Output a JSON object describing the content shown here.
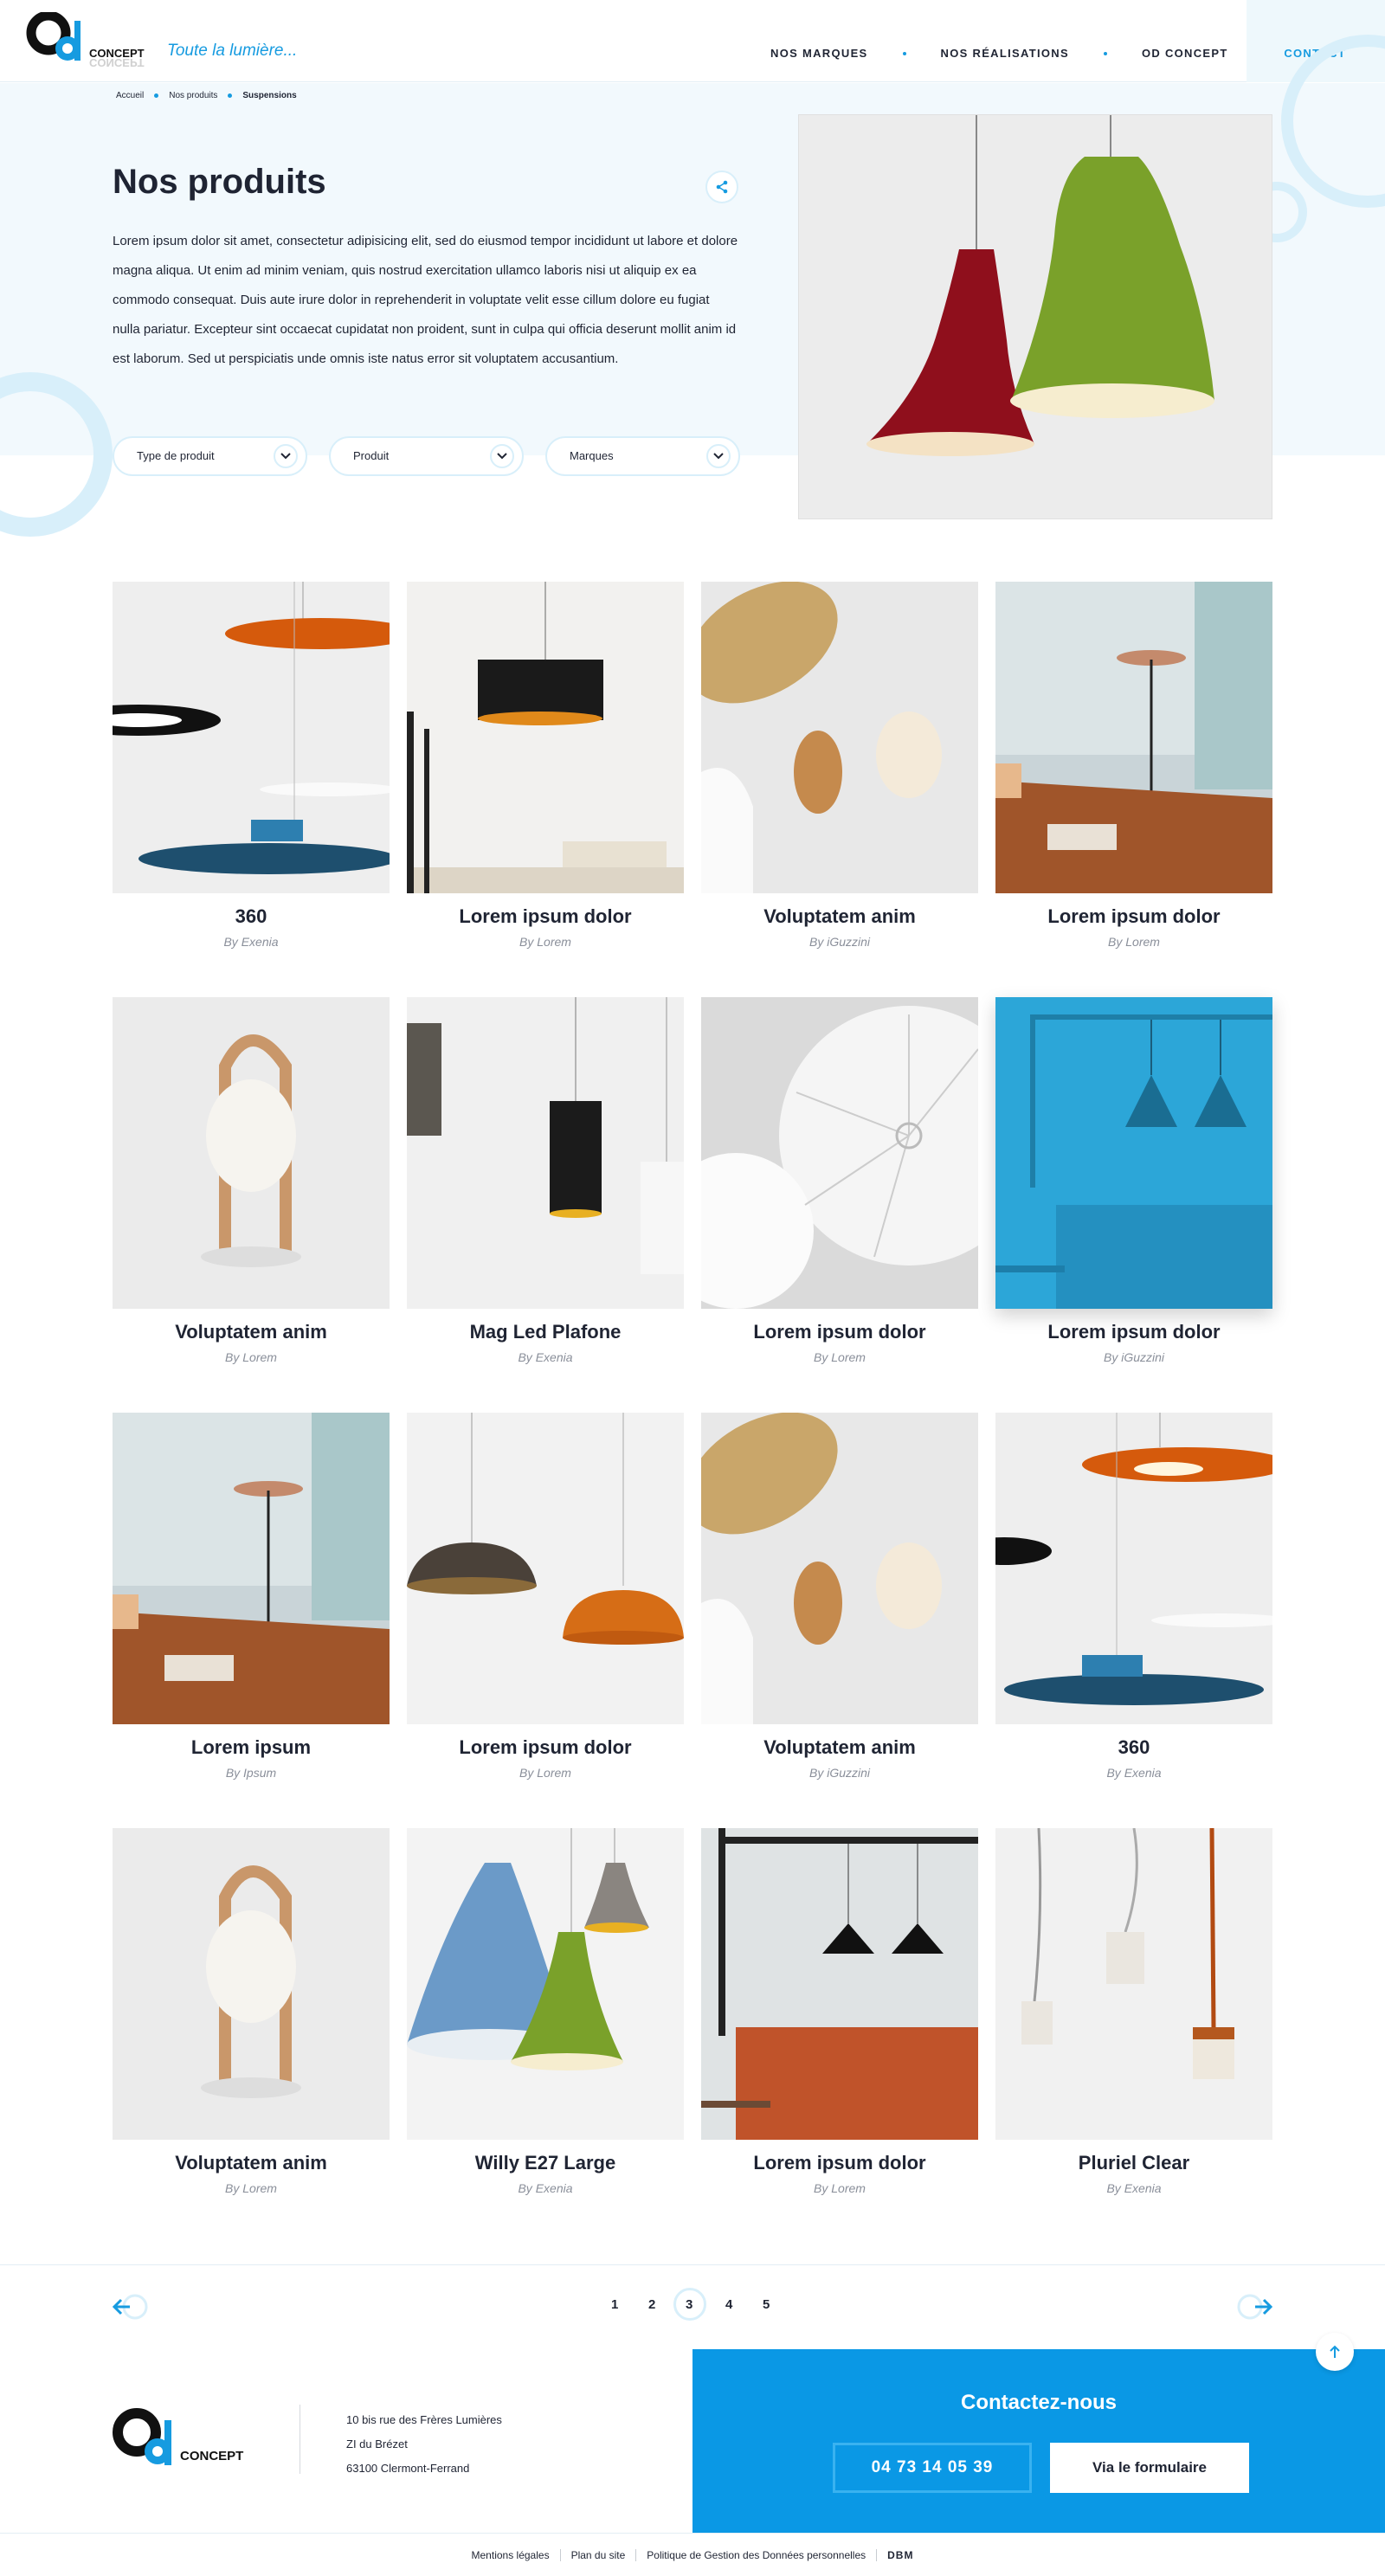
{
  "header": {
    "brand_word": "CONCEPT",
    "tagline": "Toute la lumière...",
    "nav": [
      "NOS MARQUES",
      "NOS RÉALISATIONS",
      "OD CONCEPT"
    ],
    "contact": "CONTACT"
  },
  "breadcrumb": [
    "Accueil",
    "Nos produits",
    "Suspensions"
  ],
  "hero": {
    "title": "Nos produits",
    "text": "Lorem ipsum dolor sit amet, consectetur adipisicing elit, sed do eiusmod tempor incididunt ut labore et dolore magna aliqua. Ut enim ad minim veniam, quis nostrud exercitation ullamco laboris nisi ut aliquip ex ea commodo consequat. Duis aute irure dolor in reprehenderit in voluptate velit esse cillum dolore eu fugiat nulla pariatur. Excepteur sint occaecat cupidatat non proident, sunt in culpa qui officia deserunt mollit anim id est laborum. Sed ut perspiciatis unde omnis iste natus error sit voluptatem accusantium."
  },
  "filters": [
    "Type de produit",
    "Produit",
    "Marques"
  ],
  "products": [
    {
      "name": "360",
      "brand": "By Exenia"
    },
    {
      "name": "Lorem ipsum dolor",
      "brand": "By Lorem"
    },
    {
      "name": "Voluptatem anim",
      "brand": "By iGuzzini"
    },
    {
      "name": "Lorem ipsum dolor",
      "brand": "By Lorem"
    },
    {
      "name": "Voluptatem anim",
      "brand": "By Lorem"
    },
    {
      "name": "Mag Led  Plafone",
      "brand": "By Exenia"
    },
    {
      "name": "Lorem ipsum dolor",
      "brand": "By Lorem"
    },
    {
      "name": "Lorem ipsum dolor",
      "brand": "By iGuzzini"
    },
    {
      "name": "Lorem ipsum",
      "brand": "By Ipsum"
    },
    {
      "name": "Lorem ipsum dolor",
      "brand": "By Lorem"
    },
    {
      "name": "Voluptatem anim",
      "brand": "By iGuzzini"
    },
    {
      "name": "360",
      "brand": "By Exenia"
    },
    {
      "name": "Voluptatem anim",
      "brand": "By Lorem"
    },
    {
      "name": "Willy E27 Large",
      "brand": "By Exenia"
    },
    {
      "name": "Lorem ipsum dolor",
      "brand": "By Lorem"
    },
    {
      "name": "Pluriel Clear",
      "brand": "By Exenia"
    }
  ],
  "pagination": {
    "pages": [
      "1",
      "2",
      "3",
      "4",
      "5"
    ],
    "current": "3"
  },
  "footer": {
    "brand_word": "CONCEPT",
    "address": [
      "10 bis rue des Frères Lumières",
      "ZI du Brézet",
      "63100 Clermont-Ferrand"
    ],
    "contact_title": "Contactez-nous",
    "phone": "04 73 14 05 39",
    "form_label": "Via le formulaire",
    "legal": [
      "Mentions légales",
      "Plan du site",
      "Politique de Gestion des Données personnelles",
      "DBM"
    ]
  },
  "colors": {
    "accent": "#169be0",
    "footer_blue": "#0a98e5",
    "text": "#1f2433",
    "hero_bg": "#f2f9fd"
  }
}
